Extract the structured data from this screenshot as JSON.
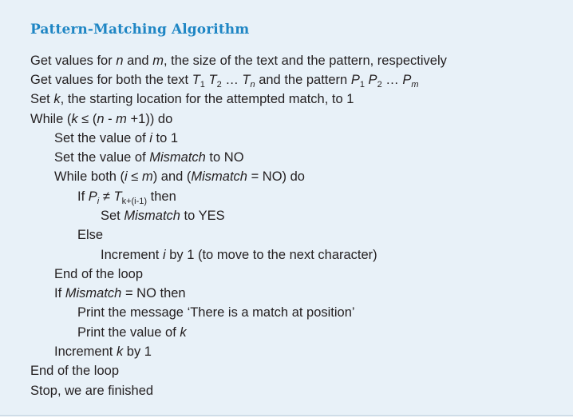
{
  "title": "Pattern-Matching Algorithm",
  "lines": {
    "l1": {
      "a": "Get values for ",
      "n": "n",
      "b": " and ",
      "m": "m",
      "c": ", the size of the text and the pattern, respectively"
    },
    "l2": {
      "a": "Get values for both the text ",
      "T": "T",
      "s1": "1",
      "s2": "2",
      "dots": " … ",
      "sn": "n",
      "b": "  and the pattern ",
      "P": "P",
      "ps1": "1",
      "ps2": "2",
      "pm": "m"
    },
    "l3": {
      "a": "Set ",
      "k": "k",
      "b": ", the starting location for the attempted match, to 1"
    },
    "l4": {
      "a": "While (",
      "k": "k",
      "le": " ≤ (",
      "n": "n",
      "minus": " - ",
      "m": "m",
      "b": " +1)) do"
    },
    "l5": {
      "a": "Set the value of ",
      "i": "i",
      "b": " to 1"
    },
    "l6": {
      "a": "Set the value of ",
      "mm": "Mismatch",
      "b": " to NO"
    },
    "l7": {
      "a": "While both (",
      "i": "i",
      "le": " ≤ ",
      "m": "m",
      "b": ") and (",
      "mm": "Mismatch",
      "c": " = NO) do"
    },
    "l8": {
      "a": "If  ",
      "P": "P",
      "pi": "i",
      "ne": "  ≠  ",
      "T": "T",
      "tsub": "k+(i-1)",
      "b": "  then"
    },
    "l9": {
      "a": "Set ",
      "mm": "Mismatch",
      "b": " to YES"
    },
    "l10": {
      "a": "Else"
    },
    "l11": {
      "a": "Increment ",
      "i": "i",
      "b": " by 1 (to move to the next character)"
    },
    "l12": {
      "a": "End of the loop"
    },
    "l13": {
      "a": "If ",
      "mm": "Mismatch",
      "b": " = NO then"
    },
    "l14": {
      "a": "Print the message ‘There is a match at position’"
    },
    "l15": {
      "a": "Print the value of ",
      "k": "k"
    },
    "l16": {
      "a": "Increment ",
      "k": "k",
      "b": " by 1"
    },
    "l17": {
      "a": "End of the loop"
    },
    "l18": {
      "a": "Stop, we are finished"
    }
  },
  "colors": {
    "title": "#1f86c4",
    "background": "#e8f1f8",
    "text": "#231f20"
  }
}
